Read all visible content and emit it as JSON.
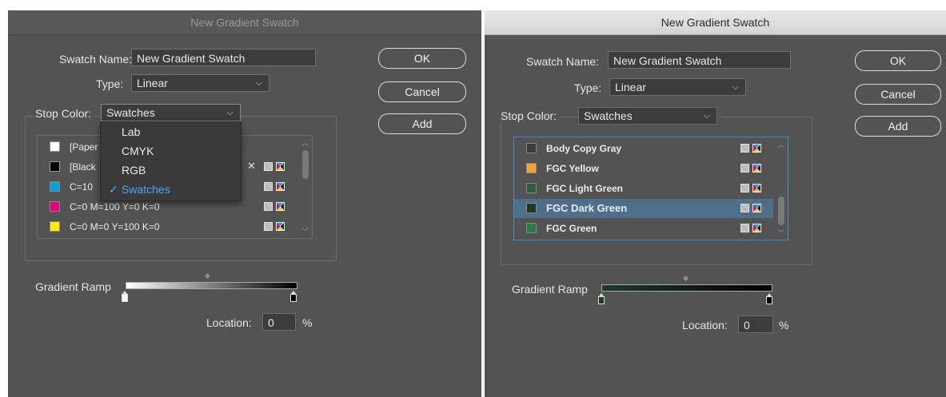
{
  "left_dialog": {
    "title": "New Gradient Swatch",
    "swatch_name_label": "Swatch Name:",
    "swatch_name_value": "New Gradient Swatch",
    "type_label": "Type:",
    "type_value": "Linear",
    "stop_color_label": "Stop Color:",
    "stop_color_value": "Swatches",
    "buttons": {
      "ok": "OK",
      "cancel": "Cancel",
      "add": "Add"
    },
    "menu": {
      "items": [
        "Lab",
        "CMYK",
        "RGB",
        "Swatches"
      ],
      "checked": "Swatches",
      "check_glyph": "✓"
    },
    "swatches": [
      {
        "name": "[Paper]",
        "visible_name": "[Paper",
        "color": "#ffffff",
        "icons": []
      },
      {
        "name": "[Black]",
        "visible_name": "[Black",
        "color": "#000000",
        "icons": [
          "no-edit-icon",
          "tint-icon",
          "cmyk-icon"
        ]
      },
      {
        "name": "C=100",
        "visible_name": "C=10",
        "color": "#00a3e0",
        "icons": [
          "tint-icon",
          "cmyk-icon"
        ]
      },
      {
        "name": "C=0 M=100 Y=0 K=0",
        "visible_name": "C=0 M=100 Y=0 K=0",
        "color": "#e6007e",
        "icons": [
          "tint-icon",
          "cmyk-icon"
        ]
      },
      {
        "name": "C=0 M=0 Y=100 K=0",
        "visible_name": "C=0 M=0 Y=100 K=0",
        "color": "#ffed00",
        "icons": [
          "tint-icon",
          "cmyk-icon"
        ]
      }
    ],
    "gradient_ramp_label": "Gradient Ramp",
    "ramp_colors": [
      "#ffffff",
      "#000000"
    ],
    "location_label": "Location:",
    "location_value": "0",
    "percent": "%"
  },
  "right_dialog": {
    "title": "New Gradient Swatch",
    "swatch_name_label": "Swatch Name:",
    "swatch_name_value": "New Gradient Swatch",
    "type_label": "Type:",
    "type_value": "Linear",
    "stop_color_label": "Stop Color:",
    "stop_color_value": "Swatches",
    "buttons": {
      "ok": "OK",
      "cancel": "Cancel",
      "add": "Add"
    },
    "swatches": [
      {
        "name": "Body Copy Gray",
        "color": "#3b3b3b",
        "selected": false
      },
      {
        "name": "FGC Yellow",
        "color": "#f2a530",
        "selected": false
      },
      {
        "name": "FGC Light Green",
        "color": "#2e5e3f",
        "selected": false
      },
      {
        "name": "FGC Dark Green",
        "color": "#1d3b25",
        "selected": true
      },
      {
        "name": "FGC Green",
        "color": "#2a7b48",
        "selected": false
      }
    ],
    "gradient_ramp_label": "Gradient Ramp",
    "ramp_colors": [
      "#1d3b25",
      "#000000"
    ],
    "location_label": "Location:",
    "location_value": "0",
    "percent": "%"
  },
  "colors": {
    "dialog_bg": "#535353",
    "selection": "#4f6e8a",
    "focus_border": "#3d8fd8",
    "menu_selected": "#4aa6ff"
  }
}
